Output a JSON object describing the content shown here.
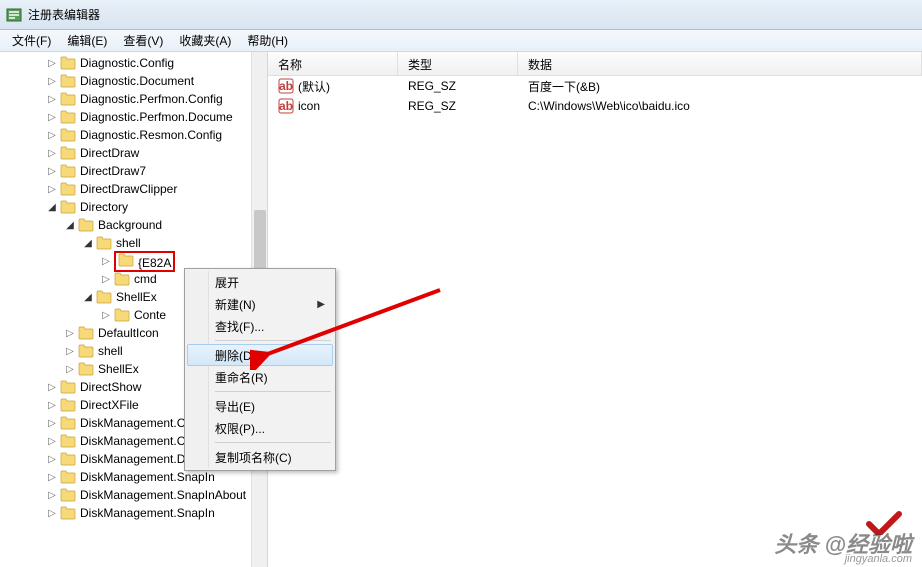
{
  "window": {
    "title": "注册表编辑器"
  },
  "menubar": {
    "file": "文件(F)",
    "edit": "编辑(E)",
    "view": "查看(V)",
    "favorites": "收藏夹(A)",
    "help": "帮助(H)"
  },
  "tree": {
    "items": [
      {
        "label": "Diagnostic.Config",
        "indent": 1,
        "expanded": false
      },
      {
        "label": "Diagnostic.Document",
        "indent": 1,
        "expanded": false
      },
      {
        "label": "Diagnostic.Perfmon.Config",
        "indent": 1,
        "expanded": false
      },
      {
        "label": "Diagnostic.Perfmon.Docume",
        "indent": 1,
        "expanded": false
      },
      {
        "label": "Diagnostic.Resmon.Config",
        "indent": 1,
        "expanded": false
      },
      {
        "label": "DirectDraw",
        "indent": 1,
        "expanded": false
      },
      {
        "label": "DirectDraw7",
        "indent": 1,
        "expanded": false
      },
      {
        "label": "DirectDrawClipper",
        "indent": 1,
        "expanded": false
      },
      {
        "label": "Directory",
        "indent": 1,
        "expanded": true
      },
      {
        "label": "Background",
        "indent": 2,
        "expanded": true
      },
      {
        "label": "shell",
        "indent": 3,
        "expanded": true
      },
      {
        "label": "{E82A",
        "indent": 4,
        "expanded": false,
        "highlight": true
      },
      {
        "label": "cmd",
        "indent": 4,
        "expanded": false
      },
      {
        "label": "ShellEx",
        "indent": 3,
        "expanded": true
      },
      {
        "label": "Conte",
        "indent": 4,
        "expanded": false
      },
      {
        "label": "DefaultIcon",
        "indent": 2,
        "expanded": false
      },
      {
        "label": "shell",
        "indent": 2,
        "expanded": false
      },
      {
        "label": "ShellEx",
        "indent": 2,
        "expanded": false
      },
      {
        "label": "DirectShow",
        "indent": 1,
        "expanded": false
      },
      {
        "label": "DirectXFile",
        "indent": 1,
        "expanded": false
      },
      {
        "label": "DiskManagement.Control",
        "indent": 1,
        "expanded": false
      },
      {
        "label": "DiskManagement.Control",
        "indent": 1,
        "expanded": false
      },
      {
        "label": "DiskManagement.DataObject",
        "indent": 1,
        "expanded": false
      },
      {
        "label": "DiskManagement.SnapIn",
        "indent": 1,
        "expanded": false
      },
      {
        "label": "DiskManagement.SnapInAbout",
        "indent": 1,
        "expanded": false
      },
      {
        "label": "DiskManagement.SnapIn",
        "indent": 1,
        "expanded": false
      }
    ]
  },
  "list": {
    "headers": {
      "name": "名称",
      "type": "类型",
      "data": "数据"
    },
    "rows": [
      {
        "name": "(默认)",
        "type": "REG_SZ",
        "data": "百度一下(&B)"
      },
      {
        "name": "icon",
        "type": "REG_SZ",
        "data": "C:\\Windows\\Web\\ico\\baidu.ico"
      }
    ]
  },
  "context_menu": {
    "expand": "展开",
    "new": "新建(N)",
    "find": "查找(F)...",
    "delete": "删除(D)",
    "rename": "重命名(R)",
    "export": "导出(E)",
    "permissions": "权限(P)...",
    "copy_key_name": "复制项名称(C)"
  },
  "watermark": {
    "main": "头条 @经验啦",
    "sub": "jingyanla.com"
  }
}
